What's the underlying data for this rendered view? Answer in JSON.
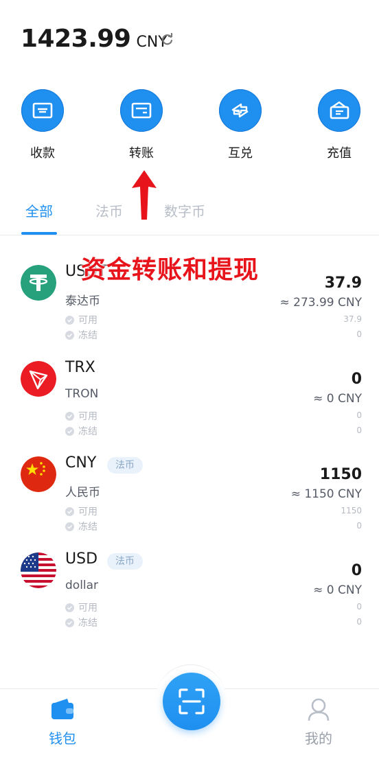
{
  "header": {
    "balance": "1423.99",
    "currency": "CNY",
    "refresh_icon": "refresh-icon"
  },
  "actions": [
    {
      "label": "收款",
      "icon": "receive-icon"
    },
    {
      "label": "转账",
      "icon": "transfer-icon"
    },
    {
      "label": "互兑",
      "icon": "exchange-icon"
    },
    {
      "label": "充值",
      "icon": "deposit-icon"
    }
  ],
  "annotation": {
    "text": "资金转账和提现",
    "color": "#e8141b"
  },
  "tabs": [
    {
      "label": "全部",
      "active": true
    },
    {
      "label": "法币",
      "active": false
    },
    {
      "label": "数字币",
      "active": false
    }
  ],
  "labels": {
    "available": "可用",
    "frozen": "冻结"
  },
  "coins": [
    {
      "symbol": "USDT",
      "name": "泰达币",
      "tag": "",
      "total": "37.9",
      "approx": "≈ 273.99 CNY",
      "available": "37.9",
      "frozen": "0",
      "logo": "tether-logo"
    },
    {
      "symbol": "TRX",
      "name": "TRON",
      "tag": "",
      "total": "0",
      "approx": "≈ 0 CNY",
      "available": "0",
      "frozen": "0",
      "logo": "tron-logo"
    },
    {
      "symbol": "CNY",
      "name": "人民币",
      "tag": "法币",
      "total": "1150",
      "approx": "≈ 1150 CNY",
      "available": "1150",
      "frozen": "0",
      "logo": "china-flag"
    },
    {
      "symbol": "USD",
      "name": "dollar",
      "tag": "法币",
      "total": "0",
      "approx": "≈ 0 CNY",
      "available": "0",
      "frozen": "0",
      "logo": "us-flag"
    }
  ],
  "bottom_nav": [
    {
      "label": "钱包",
      "icon": "wallet-icon",
      "active": true
    },
    {
      "label": "我的",
      "icon": "user-icon",
      "active": false
    }
  ],
  "colors": {
    "accent": "#1f8ff0",
    "inactive": "#b8bec8"
  }
}
